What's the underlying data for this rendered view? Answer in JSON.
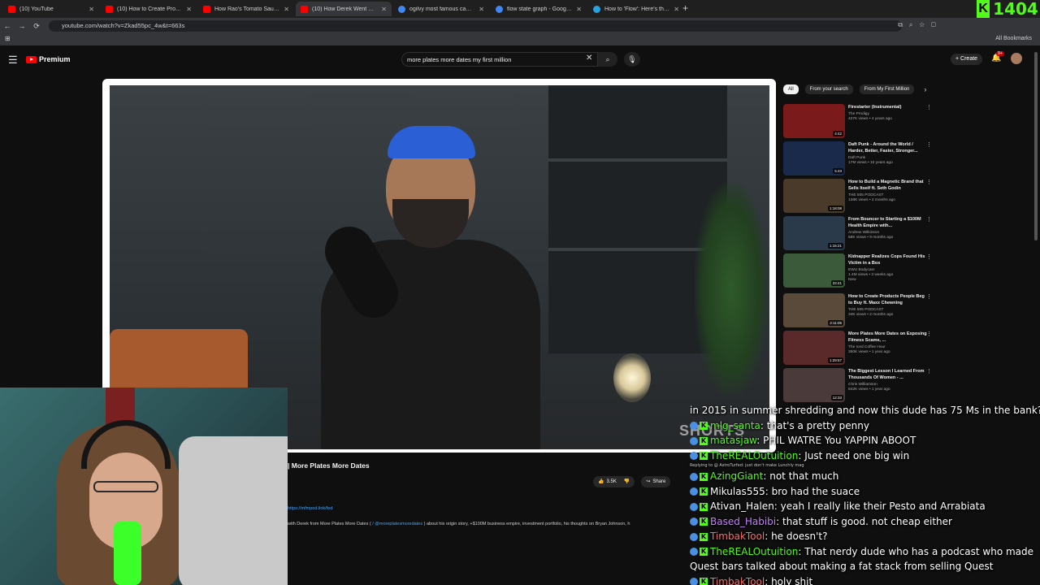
{
  "browser": {
    "tabs": [
      {
        "title": "(10) YouTube",
        "favicon_color": "#ff0000",
        "active": false
      },
      {
        "title": "(10) How to Create Products P",
        "favicon_color": "#ff0000",
        "active": false
      },
      {
        "title": "How Rao's Tomato Sauce Becam",
        "favicon_color": "#ff0000",
        "active": false
      },
      {
        "title": "(10) How Derek Went From",
        "favicon_color": "#ff0000",
        "active": true
      },
      {
        "title": "ogilvy most famous campaigns",
        "favicon_color": "#4285f4",
        "active": false
      },
      {
        "title": "flow state graph - Google Sear",
        "favicon_color": "#4285f4",
        "active": false
      },
      {
        "title": "How to 'Flow': Here's the most",
        "favicon_color": "#29a3e0",
        "active": false
      }
    ],
    "new_tab": "+",
    "url": "youtube.com/watch?v=Zkad55pc_4w&t=663s",
    "bookmarks_label": "All Bookmarks",
    "kick_count": "1404"
  },
  "youtube": {
    "logo_text": "Premium",
    "search_query": "more plates more dates my first million",
    "create_label": "Create",
    "notif_count": "9+",
    "chips": [
      {
        "label": "All",
        "active": true
      },
      {
        "label": "From your search",
        "active": false
      },
      {
        "label": "From My First Million",
        "active": false
      }
    ],
    "video_title": "| More Plates More Dates",
    "like_count": "3.5K",
    "share_label": "Share",
    "desc_link": "https://mfmpod.link/fed",
    "desc_text_prefix": "with Derek from More Plates More Dates (",
    "desc_handle": "/ @moreplatesmoredates",
    "desc_text_suffix": ") about his origin story, +$100M business empire, investment portfolio, his thoughts on Bryan Johnson, h",
    "watermark": "SHORTS",
    "recommendations": [
      {
        "title": "Firestarter (Instrumental)",
        "channel": "The Prodigy",
        "meta": "437K views • 4 years ago",
        "duration": "4:42",
        "thumb_color": "#7a1a1a"
      },
      {
        "title": "Daft Punk - Around the World / Harder, Better, Faster, Stronger...",
        "channel": "Daft Punk",
        "meta": "17M views • 10 years ago",
        "duration": "5:43",
        "thumb_color": "#1a2a4a"
      },
      {
        "title": "How to Build a Magnetic Brand that Sells Itself ft. Seth Godin",
        "channel": "THE 505 PODCAST",
        "meta": "138K views • 2 months ago",
        "duration": "1:18:08",
        "thumb_color": "#4a3a2a"
      },
      {
        "title": "From Bouncer to Starting a $100M Health Empire with...",
        "channel": "Andrew Wilkinson",
        "meta": "58K views • 9 months ago",
        "duration": "1:15:21",
        "thumb_color": "#2a3a4a"
      },
      {
        "title": "Kidnapper Realizes Cops Found His Victim in a Box",
        "channel": "EWU Bodycam",
        "meta": "1.4M views • 3 weeks ago",
        "duration": "22:41",
        "thumb_color": "#3a5a3a",
        "badge": "New"
      },
      {
        "title": "How to Create Products People Beg to Buy ft. Maxx Chewning",
        "channel": "THE 505 PODCAST",
        "meta": "34K views • 2 months ago",
        "duration": "2:11:05",
        "thumb_color": "#5a4a3a"
      },
      {
        "title": "More Plates More Dates on Exposing Fitness Scams, ...",
        "channel": "The Iced Coffee Hour",
        "meta": "350K views • 1 year ago",
        "duration": "1:29:57",
        "thumb_color": "#5a2a2a"
      },
      {
        "title": "The Biggest Lesson I Learned From Thousands Of Women - ...",
        "channel": "Chris Williamson",
        "meta": "842K views • 1 year ago",
        "duration": "12:33",
        "thumb_color": "#4a3a3a"
      }
    ]
  },
  "chat": {
    "messages": [
      {
        "user": "",
        "user_color": "#ffffff",
        "badge": "none",
        "text": "in 2015 in summer shredding and now this dude has 75 Ms in the bank?"
      },
      {
        "user": "mlg_santa",
        "user_color": "#53fc18",
        "badge": "sub-kick",
        "text": "that's a pretty penny"
      },
      {
        "user": "matasjaw",
        "user_color": "#53fc18",
        "badge": "sub-kick",
        "text": "PHIL WATRE You YAPPIN ABOOT"
      },
      {
        "user": "TheREALOutuition",
        "user_color": "#53fc18",
        "badge": "sub-kick",
        "text": "Just need one big win"
      },
      {
        "user": "AzingGiant",
        "user_color": "#53fc18",
        "badge": "sub-kick",
        "text": "not that much",
        "reply": "Replying to @ AstroTurfed: just don't make Lunchly mag"
      },
      {
        "user": "Mikulas555",
        "user_color": "#ffffff",
        "badge": "sub-kick",
        "text": "bro had the suace"
      },
      {
        "user": "Ativan_Halen",
        "user_color": "#ffffff",
        "badge": "sub-kick",
        "text": "yeah I really like their Pesto and Arrabiata"
      },
      {
        "user": "Based_Habibi",
        "user_color": "#c77dff",
        "badge": "sub-kick",
        "text": "that stuff is good. not cheap either"
      },
      {
        "user": "TimbakTool",
        "user_color": "#ff6b6b",
        "badge": "sub-kick",
        "text": "he doesn't?"
      },
      {
        "user": "TheREALOutuition",
        "user_color": "#53fc18",
        "badge": "sub-kick",
        "text": "That nerdy dude who has a podcast who made Quest bars talked about making a fat stack from selling Quest"
      },
      {
        "user": "TimbakTool",
        "user_color": "#ff6b6b",
        "badge": "sub-kick",
        "text": "holy shit"
      }
    ]
  }
}
